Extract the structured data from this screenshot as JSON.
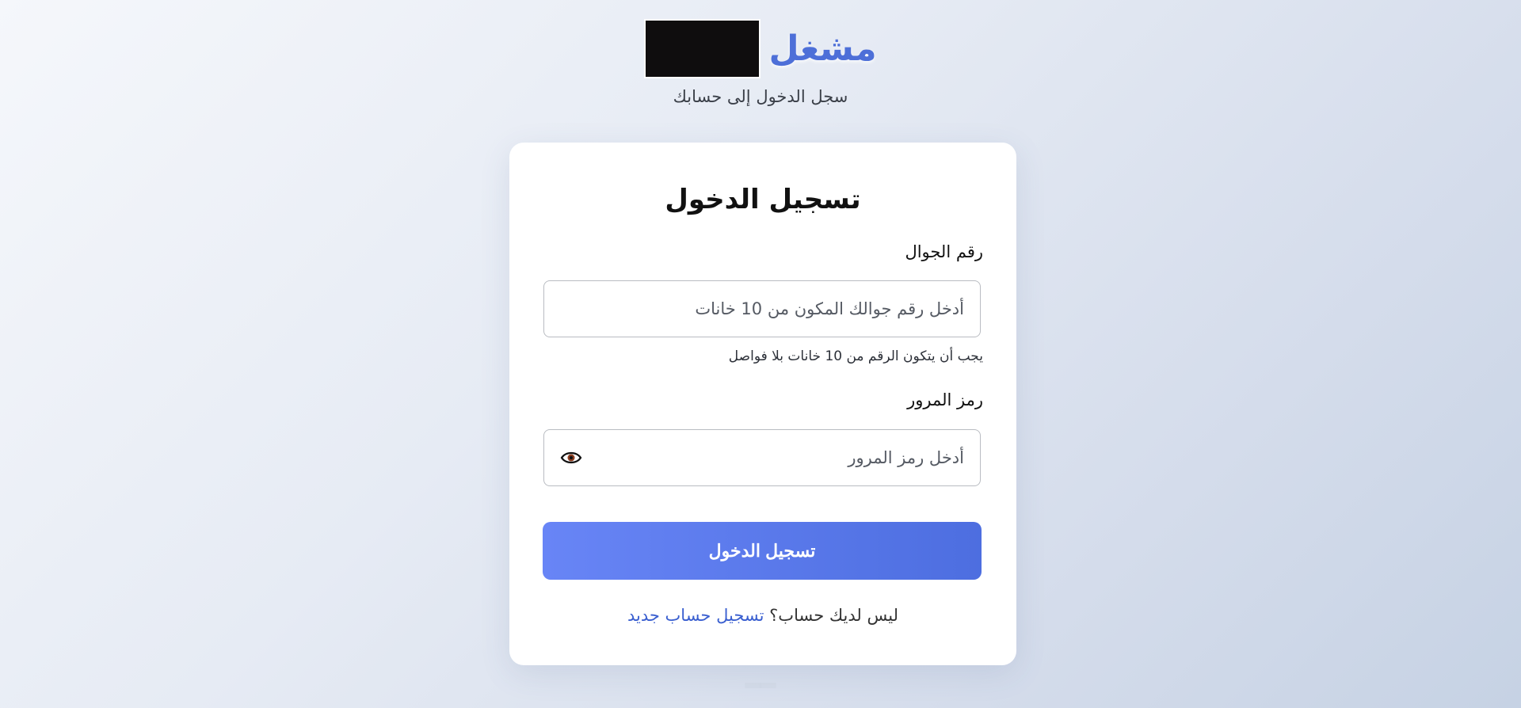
{
  "brand": {
    "name": "مشغل",
    "subtitle": "سجل الدخول إلى حسابك"
  },
  "login_form": {
    "title": "تسجيل الدخول",
    "phone": {
      "label": "رقم الجوال",
      "placeholder": "أدخل رقم جوالك المكون من 10 خانات",
      "hint": "يجب أن يتكون الرقم من 10 خانات بلا فواصل"
    },
    "password": {
      "label": "رمز المرور",
      "placeholder": "أدخل رمز المرور",
      "toggle_icon": "eye-icon"
    },
    "submit_label": "تسجيل الدخول",
    "register_prompt": "ليس لديك حساب؟",
    "register_link": "تسجيل حساب جديد"
  },
  "colors": {
    "accent": "#4d6fd8",
    "button_start": "#6885f6",
    "button_end": "#4d6ee0",
    "link": "#3a5fd0"
  }
}
